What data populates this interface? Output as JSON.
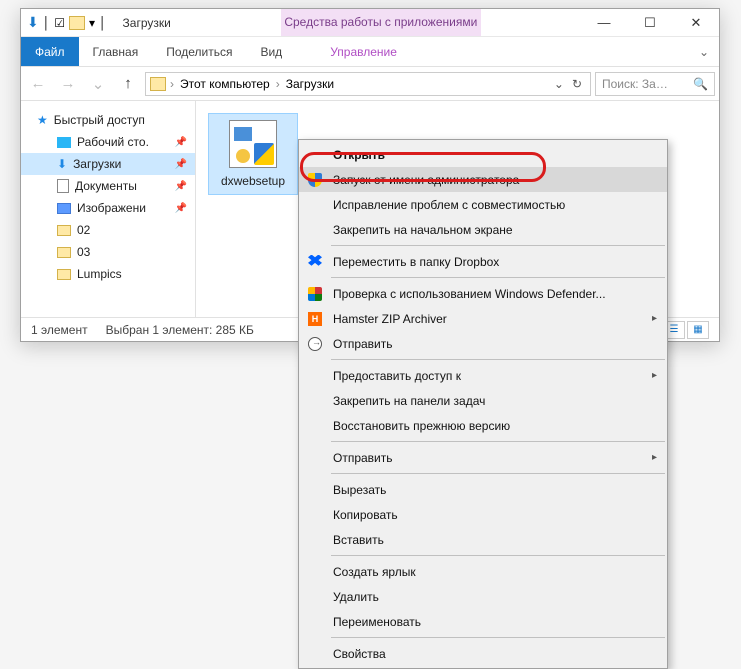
{
  "titlebar": {
    "title": "Загрузки",
    "context_tab": "Средства работы с приложениями"
  },
  "winbtns": {
    "min": "—",
    "max": "☐",
    "close": "✕"
  },
  "ribbon": {
    "file": "Файл",
    "home": "Главная",
    "share": "Поделиться",
    "view": "Вид",
    "contextual": "Управление",
    "expand": "⌄"
  },
  "addrbar": {
    "back": "←",
    "fwd": "→",
    "up": "↑",
    "root": "Этот компьютер",
    "current": "Загрузки",
    "chev": "›",
    "dropdown": "⌄",
    "refresh": "↻",
    "search_placeholder": "Поиск: За…",
    "search_icon": "🔍"
  },
  "sidebar": {
    "quick": "Быстрый доступ",
    "items": [
      {
        "label": "Рабочий сто.",
        "kind": "blue",
        "pin": true
      },
      {
        "label": "Загрузки",
        "kind": "dl",
        "pin": true,
        "selected": true
      },
      {
        "label": "Документы",
        "kind": "doc",
        "pin": true
      },
      {
        "label": "Изображени",
        "kind": "img",
        "pin": true
      },
      {
        "label": "02",
        "kind": "folder"
      },
      {
        "label": "03",
        "kind": "folder"
      },
      {
        "label": "Lumpics",
        "kind": "folder"
      }
    ]
  },
  "content": {
    "file_label": "dxwebsetup"
  },
  "statusbar": {
    "count": "1 элемент",
    "selection": "Выбран 1 элемент: 285 КБ"
  },
  "context_menu": {
    "open": "Открыть",
    "run_admin": "Запуск от имени администратора",
    "troubleshoot": "Исправление проблем с совместимостью",
    "pin_start": "Закрепить на начальном экране",
    "dropbox": "Переместить в папку Dropbox",
    "defender": "Проверка с использованием Windows Defender...",
    "hamster": "Hamster ZIP Archiver",
    "share": "Отправить",
    "give_access": "Предоставить доступ к",
    "pin_taskbar": "Закрепить на панели задач",
    "restore": "Восстановить прежнюю версию",
    "send_to": "Отправить",
    "cut": "Вырезать",
    "copy": "Копировать",
    "paste": "Вставить",
    "shortcut": "Создать ярлык",
    "delete": "Удалить",
    "rename": "Переименовать",
    "properties": "Свойства",
    "h_label": "H"
  }
}
